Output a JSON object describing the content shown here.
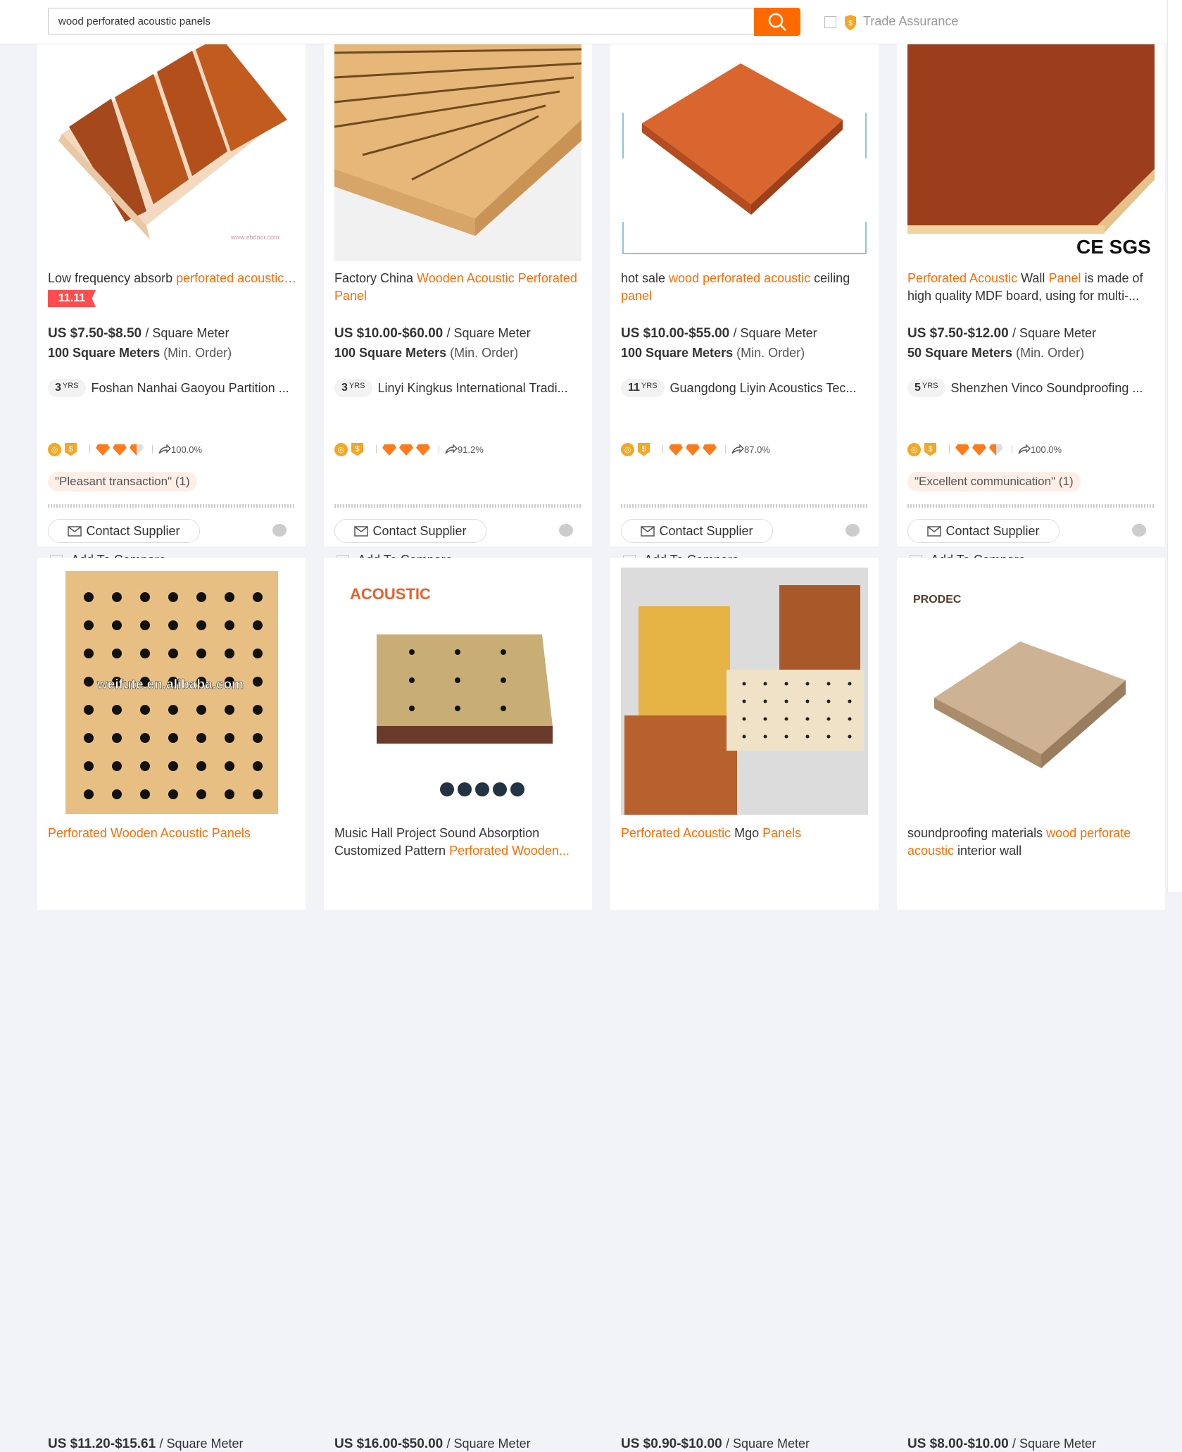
{
  "search": {
    "query": "wood perforated acoustic panels",
    "trade_assurance_label": "Trade Assurance"
  },
  "labels": {
    "contact": "Contact Supplier",
    "compare": "Add To Compare",
    "more": "···",
    "yrs": "YRS",
    "min_order": "(Min. Order)"
  },
  "products": [
    {
      "title_parts": [
        {
          "t": "Low frequency absorb ",
          "hl": false
        },
        {
          "t": "perforated acoustic…",
          "hl": true
        }
      ],
      "badge": "11.11",
      "price": "US $7.50-$8.50",
      "unit": "/ Square Meter",
      "moq": "100 Square Meters",
      "years": "3",
      "supplier": "Foshan Nanhai Gaoyou Partition ...",
      "diamonds": 2.5,
      "response": "100.0%",
      "review": "\"Pleasant transaction\" (1)"
    },
    {
      "title_parts": [
        {
          "t": "Factory China ",
          "hl": false
        },
        {
          "t": "Wooden Acoustic Perforated Panel",
          "hl": true
        }
      ],
      "price": "US $10.00-$60.00",
      "unit": "/ Square Meter",
      "moq": "100 Square Meters",
      "years": "3",
      "supplier": "Linyi Kingkus International Tradi...",
      "diamonds": 3,
      "response": "91.2%",
      "review": ""
    },
    {
      "title_parts": [
        {
          "t": "hot sale ",
          "hl": false
        },
        {
          "t": "wood perforated acoustic",
          "hl": true
        },
        {
          "t": " ceiling ",
          "hl": false
        },
        {
          "t": "panel",
          "hl": true
        }
      ],
      "price": "US $10.00-$55.00",
      "unit": "/ Square Meter",
      "moq": "100 Square Meters",
      "years": "11",
      "supplier": "Guangdong Liyin Acoustics Tec...",
      "diamonds": 3,
      "response": "87.0%",
      "review": ""
    },
    {
      "title_parts": [
        {
          "t": "Perforated Acoustic",
          "hl": true
        },
        {
          "t": " Wall ",
          "hl": false
        },
        {
          "t": "Panel",
          "hl": true
        },
        {
          "t": " is made of high quality MDF board, using for multi-...",
          "hl": false
        }
      ],
      "price": "US $7.50-$12.00",
      "unit": "/ Square Meter",
      "moq": "50 Square Meters",
      "years": "5",
      "supplier": "Shenzhen Vinco Soundproofing ...",
      "diamonds": 2.5,
      "response": "100.0%",
      "review": "\"Excellent communication\" (1)"
    },
    {
      "title_parts": [
        {
          "t": "Perforated Wooden Acoustic Panels",
          "hl": true
        }
      ],
      "price": "US $11.20-$15.61",
      "unit": "/ Square Meter",
      "image_text": "weifute.en.alibaba.com"
    },
    {
      "title_parts": [
        {
          "t": "Music Hall Project Sound Absorption Customized Pattern ",
          "hl": false
        },
        {
          "t": "Perforated Wooden...",
          "hl": true
        }
      ],
      "price": "US $16.00-$50.00",
      "unit": "/ Square Meter",
      "image_text": "ACOUSTIC"
    },
    {
      "title_parts": [
        {
          "t": "Perforated Acoustic",
          "hl": true
        },
        {
          "t": " Mgo ",
          "hl": false
        },
        {
          "t": "Panels",
          "hl": true
        }
      ],
      "price": "US $0.90-$10.00",
      "unit": "/ Square Meter"
    },
    {
      "title_parts": [
        {
          "t": "soundproofing materials ",
          "hl": false
        },
        {
          "t": "wood perforate acoustic",
          "hl": true
        },
        {
          "t": " interior wall",
          "hl": false
        }
      ],
      "price": "US $8.00-$10.00",
      "unit": "/ Square Meter",
      "image_text": "PRODEC"
    }
  ],
  "colors": {
    "accent": "#ff6a00",
    "badge": "#ff4d4f",
    "gold": "#f5a623"
  }
}
